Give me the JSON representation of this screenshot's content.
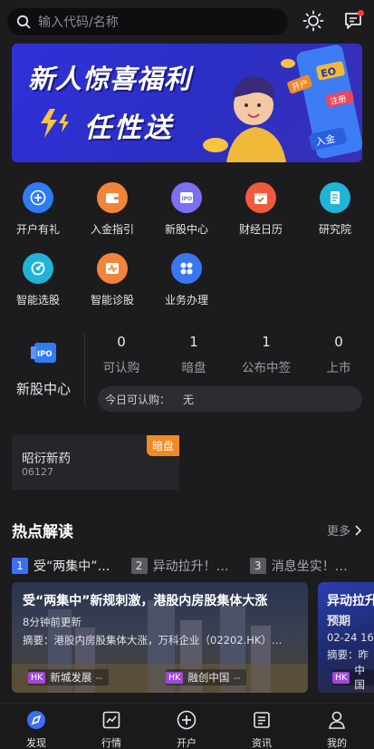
{
  "search": {
    "placeholder": "输入代码/名称"
  },
  "banner": {
    "line1": "新人惊喜福利",
    "line2": "任性送",
    "art_labels": [
      "EO",
      "注册",
      "开户",
      "入金"
    ]
  },
  "grid": [
    {
      "label": "开户有礼",
      "icon": "plus-icon",
      "color": "#2f7bf5"
    },
    {
      "label": "入金指引",
      "icon": "wallet-icon",
      "color": "#f2843a"
    },
    {
      "label": "新股中心",
      "icon": "ipo-icon",
      "color": "#7b6ff2"
    },
    {
      "label": "财经日历",
      "icon": "calendar-icon",
      "color": "#f05a3c"
    },
    {
      "label": "研究院",
      "icon": "document-icon",
      "color": "#22b3d8"
    },
    {
      "label": "智能选股",
      "icon": "target-icon",
      "color": "#22b3d8"
    },
    {
      "label": "智能诊股",
      "icon": "pulse-icon",
      "color": "#f2843a"
    },
    {
      "label": "业务办理",
      "icon": "apps-icon",
      "color": "#3a76f2"
    }
  ],
  "ipo": {
    "label": "新股中心",
    "icon_text": "IPO",
    "stats": [
      {
        "value": "0",
        "label": "可认购"
      },
      {
        "value": "1",
        "label": "暗盘"
      },
      {
        "value": "1",
        "label": "公布中签"
      },
      {
        "value": "0",
        "label": "上市"
      }
    ],
    "today_label": "今日可认购：",
    "today_value": "无"
  },
  "stock_card": {
    "name": "昭衍新药",
    "code": "06127",
    "tag": "暗盘"
  },
  "hot": {
    "title": "热点解读",
    "more": "更多",
    "tabs": [
      {
        "num": "1",
        "text": "受“两集中”…"
      },
      {
        "num": "2",
        "text": "异动拉升！…"
      },
      {
        "num": "3",
        "text": "消息坐实！…"
      }
    ],
    "cards": [
      {
        "headline": "受“两集中”新规刺激，港股内房股集体大涨",
        "time": "8分钟前更新",
        "summary": "摘要：港股内房股集体大涨，万科企业（02202.HK）…",
        "chips": [
          {
            "tag": "HK",
            "name": "新城发展",
            "change": "--"
          },
          {
            "tag": "HK",
            "name": "融创中国",
            "change": "--"
          }
        ]
      },
      {
        "headline": "异动拉升",
        "time": "预期",
        "date": "02-24 16",
        "summary": "摘要：昨",
        "chips": [
          {
            "tag": "HK",
            "name": "中国",
            "change": ""
          }
        ]
      }
    ]
  },
  "tabbar": [
    {
      "label": "发现",
      "icon": "compass-icon",
      "active": true
    },
    {
      "label": "行情",
      "icon": "chart-icon",
      "active": false
    },
    {
      "label": "开户",
      "icon": "plus-circle-icon",
      "active": false
    },
    {
      "label": "资讯",
      "icon": "news-icon",
      "active": false
    },
    {
      "label": "我的",
      "icon": "person-icon",
      "active": false
    }
  ],
  "colors": {
    "background": "#1c1c1e",
    "accent": "#3a6ff7",
    "orange": "#f08a24",
    "hk_tag": "#a046d8"
  }
}
